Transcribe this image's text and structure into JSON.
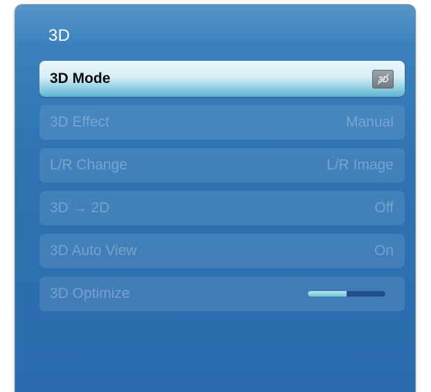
{
  "header": {
    "title": "3D"
  },
  "menu": {
    "items": [
      {
        "label": "3D Mode",
        "value": "",
        "icon": "3d-mode-off-icon",
        "selected": true
      },
      {
        "label": "3D Effect",
        "value": "Manual"
      },
      {
        "label": "L/R Change",
        "value": "L/R Image"
      },
      {
        "label": "3D → 2D",
        "value": "Off"
      },
      {
        "label": "3D Auto View",
        "value": "On"
      },
      {
        "label": "3D Optimize",
        "value": "",
        "slider_level": 0.5
      }
    ]
  },
  "colors": {
    "panel": "#2f73b2",
    "selected_highlight": "#d7eef6",
    "slider_fill": "#6fc3d8",
    "slider_track": "#20508a"
  }
}
